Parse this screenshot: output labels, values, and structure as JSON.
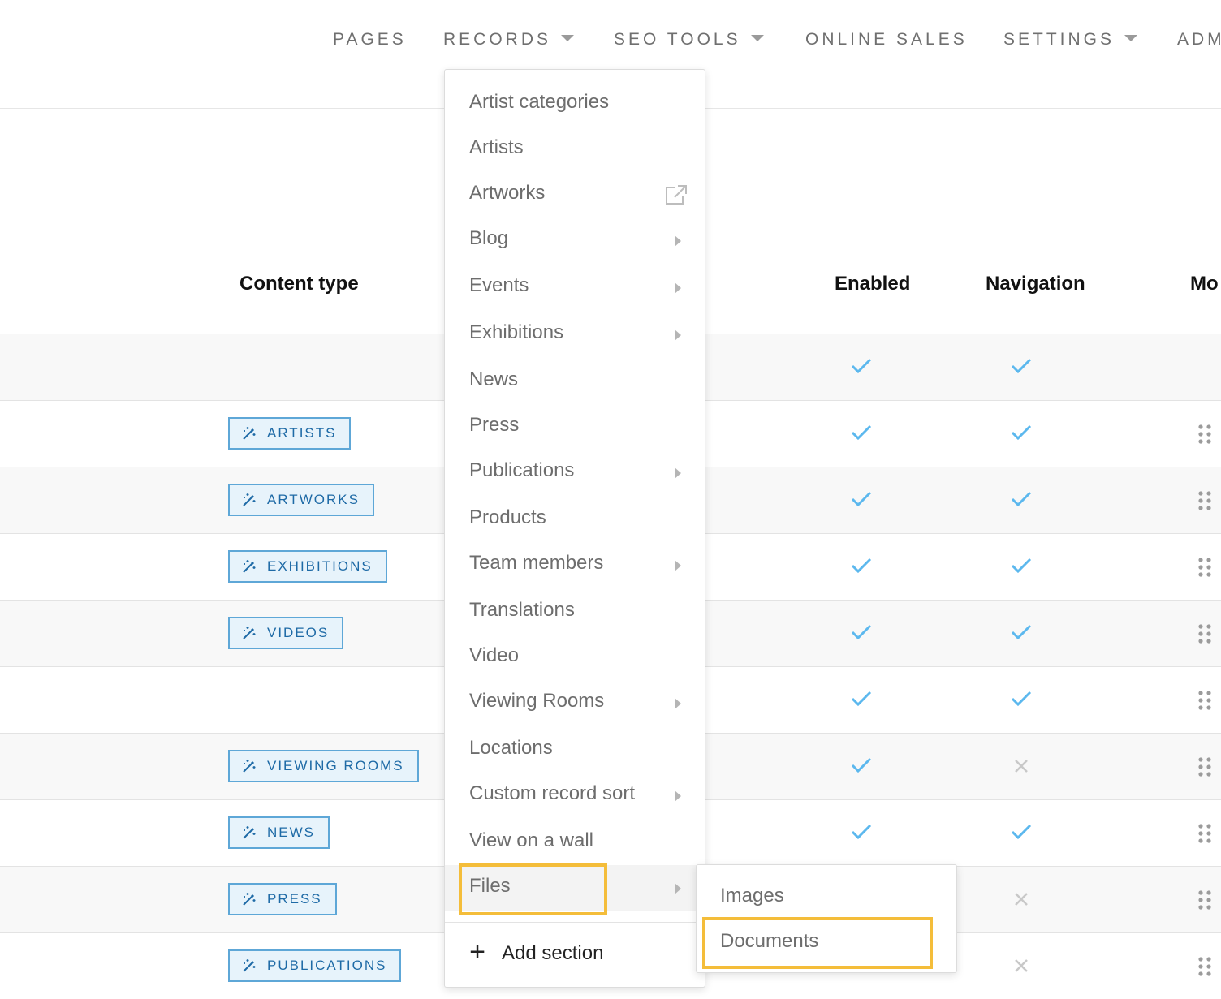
{
  "nav": {
    "items": [
      {
        "label": "PAGES",
        "dropdown": false
      },
      {
        "label": "RECORDS",
        "dropdown": true
      },
      {
        "label": "SEO TOOLS",
        "dropdown": true
      },
      {
        "label": "ONLINE SALES",
        "dropdown": false
      },
      {
        "label": "SETTINGS",
        "dropdown": true
      },
      {
        "label": "ADM",
        "dropdown": false
      }
    ]
  },
  "table": {
    "headers": {
      "content_type": "Content type",
      "enabled": "Enabled",
      "navigation": "Navigation",
      "more": "Mo"
    },
    "rows": [
      {
        "badge": "",
        "enabled": true,
        "navigation": true,
        "draggable": false
      },
      {
        "badge": "ARTISTS",
        "enabled": true,
        "navigation": true,
        "draggable": true
      },
      {
        "badge": "ARTWORKS",
        "enabled": true,
        "navigation": true,
        "draggable": true
      },
      {
        "badge": "EXHIBITIONS",
        "enabled": true,
        "navigation": true,
        "draggable": true
      },
      {
        "badge": "VIDEOS",
        "enabled": true,
        "navigation": true,
        "draggable": true
      },
      {
        "badge": "",
        "enabled": true,
        "navigation": true,
        "draggable": true
      },
      {
        "badge": "VIEWING ROOMS",
        "enabled": true,
        "navigation": false,
        "draggable": true
      },
      {
        "badge": "NEWS",
        "enabled": true,
        "navigation": true,
        "draggable": true
      },
      {
        "badge": "PRESS",
        "enabled": null,
        "navigation": false,
        "draggable": true
      },
      {
        "badge": "PUBLICATIONS",
        "enabled": null,
        "navigation": false,
        "draggable": true
      }
    ]
  },
  "records_menu": {
    "items": [
      {
        "label": "Artist categories",
        "submenu": false
      },
      {
        "label": "Artists",
        "submenu": false
      },
      {
        "label": "Artworks",
        "submenu": false,
        "external_link": true
      },
      {
        "label": "Blog",
        "submenu": true
      },
      {
        "label": "Events",
        "submenu": true
      },
      {
        "label": "Exhibitions",
        "submenu": true
      },
      {
        "label": "News",
        "submenu": false
      },
      {
        "label": "Press",
        "submenu": false
      },
      {
        "label": "Publications",
        "submenu": true
      },
      {
        "label": "Products",
        "submenu": false
      },
      {
        "label": "Team members",
        "submenu": true
      },
      {
        "label": "Translations",
        "submenu": false
      },
      {
        "label": "Video",
        "submenu": false
      },
      {
        "label": "Viewing Rooms",
        "submenu": true
      },
      {
        "label": "Locations",
        "submenu": false
      },
      {
        "label": "Custom record sort",
        "submenu": true
      },
      {
        "label": "View on a wall",
        "submenu": false
      },
      {
        "label": "Files",
        "submenu": true,
        "highlighted": true
      }
    ],
    "add_section": "Add section"
  },
  "files_submenu": {
    "items": [
      {
        "label": "Images"
      },
      {
        "label": "Documents",
        "highlighted": true
      }
    ]
  },
  "colors": {
    "badge_border": "#5ea7d7",
    "badge_bg": "#e7f3fb",
    "badge_text": "#1e6aa6",
    "check": "#5cb8ee",
    "cross": "#c8c8c8",
    "highlight": "#f4bd3a"
  }
}
